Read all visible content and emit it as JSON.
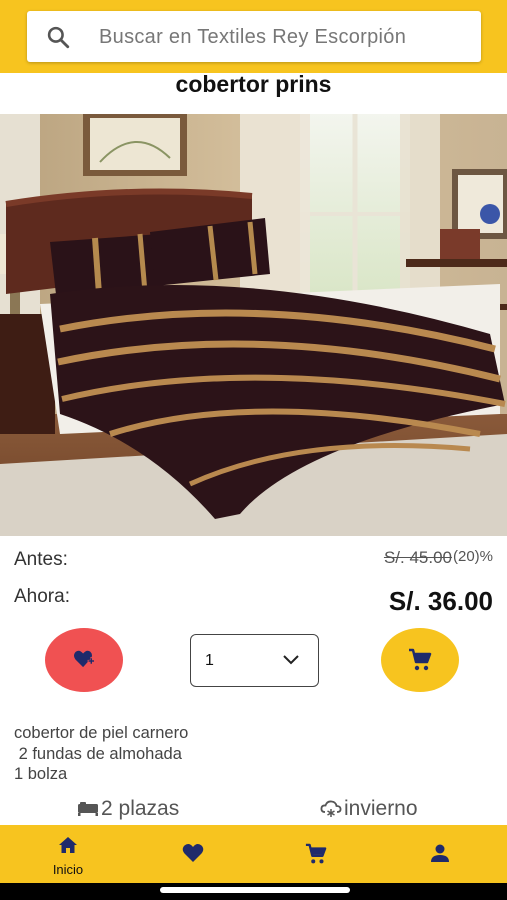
{
  "search": {
    "placeholder": "Buscar en Textiles Rey Escorpión",
    "icon": "search-icon"
  },
  "product": {
    "title": "cobertor prins",
    "image_alt": "cobertor prins",
    "price_before_label": "Antes:",
    "price_before": "S/. 45.00",
    "discount": "(20)%",
    "price_now_label": "Ahora:",
    "price_now": "S/. 36.00",
    "description": "cobertor de piel carnero\n 2 fundas de almohada\n1 bolza"
  },
  "actions": {
    "favorite_icon": "heart-plus-icon",
    "quantity": {
      "selected": "1",
      "options": [
        "1"
      ]
    },
    "cart_icon": "cart-icon"
  },
  "features": [
    {
      "icon": "bed-icon",
      "label": "2 plazas"
    },
    {
      "icon": "winter-cloud-icon",
      "label": "invierno"
    }
  ],
  "bottom_nav": [
    {
      "icon": "home-icon",
      "label": "Inicio"
    },
    {
      "icon": "heart-icon",
      "label": ""
    },
    {
      "icon": "cart-icon",
      "label": ""
    },
    {
      "icon": "person-icon",
      "label": ""
    }
  ],
  "colors": {
    "accent": "#f7c41f",
    "favorite": "#f05152",
    "icon_dark": "#1f2a6b"
  }
}
